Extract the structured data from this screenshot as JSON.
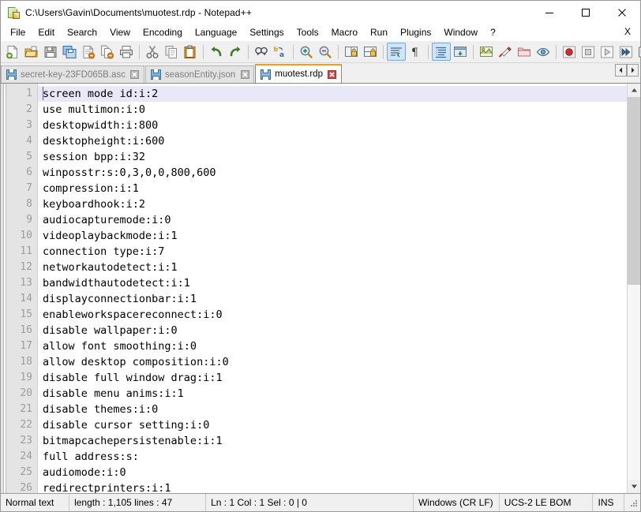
{
  "window": {
    "title": "C:\\Users\\Gavin\\Documents\\muotest.rdp - Notepad++",
    "icon": "notepad-plus-plus-icon",
    "controls": {
      "minimize": "minimize-button",
      "maximize": "maximize-button",
      "close": "close-button"
    }
  },
  "menubar": {
    "items": [
      {
        "label": "File"
      },
      {
        "label": "Edit"
      },
      {
        "label": "Search"
      },
      {
        "label": "View"
      },
      {
        "label": "Encoding"
      },
      {
        "label": "Language"
      },
      {
        "label": "Settings"
      },
      {
        "label": "Tools"
      },
      {
        "label": "Macro"
      },
      {
        "label": "Run"
      },
      {
        "label": "Plugins"
      },
      {
        "label": "Window"
      },
      {
        "label": "?"
      }
    ],
    "close_document_label": "X"
  },
  "toolbar": {
    "items": [
      {
        "name": "new-file-icon",
        "type": "button"
      },
      {
        "name": "open-file-icon",
        "type": "button"
      },
      {
        "name": "save-icon",
        "type": "button"
      },
      {
        "name": "save-all-icon",
        "type": "button"
      },
      {
        "name": "close-file-icon",
        "type": "button"
      },
      {
        "name": "close-all-files-icon",
        "type": "button"
      },
      {
        "name": "print-icon",
        "type": "button"
      },
      {
        "name": "separator",
        "type": "separator"
      },
      {
        "name": "cut-icon",
        "type": "button"
      },
      {
        "name": "copy-icon",
        "type": "button"
      },
      {
        "name": "paste-icon",
        "type": "button"
      },
      {
        "name": "separator",
        "type": "separator"
      },
      {
        "name": "undo-icon",
        "type": "button"
      },
      {
        "name": "redo-icon",
        "type": "button"
      },
      {
        "name": "separator",
        "type": "separator"
      },
      {
        "name": "find-icon",
        "type": "button"
      },
      {
        "name": "replace-icon",
        "type": "button"
      },
      {
        "name": "separator",
        "type": "separator"
      },
      {
        "name": "zoom-in-icon",
        "type": "button"
      },
      {
        "name": "zoom-out-icon",
        "type": "button"
      },
      {
        "name": "separator",
        "type": "separator"
      },
      {
        "name": "sync-vertical-scroll-icon",
        "type": "button"
      },
      {
        "name": "sync-horizontal-scroll-icon",
        "type": "button"
      },
      {
        "name": "separator",
        "type": "separator"
      },
      {
        "name": "word-wrap-icon",
        "type": "toggle",
        "active": true
      },
      {
        "name": "show-all-characters-icon",
        "type": "button"
      },
      {
        "name": "separator",
        "type": "separator"
      },
      {
        "name": "indent-guideline-icon",
        "type": "toggle",
        "active": true
      },
      {
        "name": "user-defined-dialogue-icon",
        "type": "button"
      },
      {
        "name": "separator",
        "type": "separator"
      },
      {
        "name": "document-map-icon",
        "type": "button"
      },
      {
        "name": "function-list-icon",
        "type": "button"
      },
      {
        "name": "folder-as-workspace-icon",
        "type": "button"
      },
      {
        "name": "monitoring-icon",
        "type": "button"
      },
      {
        "name": "separator",
        "type": "separator"
      },
      {
        "name": "record-macro-icon",
        "type": "button"
      },
      {
        "name": "stop-recording-macro-icon",
        "type": "button"
      },
      {
        "name": "play-macro-icon",
        "type": "button"
      },
      {
        "name": "run-macro-multiple-times-icon",
        "type": "button"
      },
      {
        "name": "save-current-macro-icon",
        "type": "button"
      }
    ]
  },
  "tabs": {
    "items": [
      {
        "label": "secret-key-23FD065B.asc",
        "active": false
      },
      {
        "label": "seasonEntity.json",
        "active": false
      },
      {
        "label": "muotest.rdp",
        "active": true
      }
    ],
    "scroll_left": "scroll-tabs-left-button",
    "scroll_right": "scroll-tabs-right-button"
  },
  "editor": {
    "current_line": 1,
    "first_visible_line": 1,
    "lines": [
      {
        "n": "1",
        "text": "screen mode id:i:2"
      },
      {
        "n": "2",
        "text": "use multimon:i:0"
      },
      {
        "n": "3",
        "text": "desktopwidth:i:800"
      },
      {
        "n": "4",
        "text": "desktopheight:i:600"
      },
      {
        "n": "5",
        "text": "session bpp:i:32"
      },
      {
        "n": "6",
        "text": "winposstr:s:0,3,0,0,800,600"
      },
      {
        "n": "7",
        "text": "compression:i:1"
      },
      {
        "n": "8",
        "text": "keyboardhook:i:2"
      },
      {
        "n": "9",
        "text": "audiocapturemode:i:0"
      },
      {
        "n": "10",
        "text": "videoplaybackmode:i:1"
      },
      {
        "n": "11",
        "text": "connection type:i:7"
      },
      {
        "n": "12",
        "text": "networkautodetect:i:1"
      },
      {
        "n": "13",
        "text": "bandwidthautodetect:i:1"
      },
      {
        "n": "14",
        "text": "displayconnectionbar:i:1"
      },
      {
        "n": "15",
        "text": "enableworkspacereconnect:i:0"
      },
      {
        "n": "16",
        "text": "disable wallpaper:i:0"
      },
      {
        "n": "17",
        "text": "allow font smoothing:i:0"
      },
      {
        "n": "18",
        "text": "allow desktop composition:i:0"
      },
      {
        "n": "19",
        "text": "disable full window drag:i:1"
      },
      {
        "n": "20",
        "text": "disable menu anims:i:1"
      },
      {
        "n": "21",
        "text": "disable themes:i:0"
      },
      {
        "n": "22",
        "text": "disable cursor setting:i:0"
      },
      {
        "n": "23",
        "text": "bitmapcachepersistenable:i:1"
      },
      {
        "n": "24",
        "text": "full address:s:"
      },
      {
        "n": "25",
        "text": "audiomode:i:0"
      },
      {
        "n": "26",
        "text": "redirectprinters:i:1"
      }
    ]
  },
  "statusbar": {
    "doc_type": "Normal text",
    "length_lines": "length : 1,105   lines : 47",
    "caret_info": "Ln : 1    Col : 1    Sel : 0 | 0",
    "eol": "Windows (CR LF)",
    "encoding": "UCS-2 LE BOM",
    "insert_mode": "INS"
  },
  "colors": {
    "accent_tab": "#ff9a14",
    "current_line_highlight": "#e8e8f8",
    "window_bg": "#f0f0f0",
    "editor_bg": "#ffffff",
    "gutter_bg": "#e4e4e4",
    "gutter_text": "#9d9d9d"
  }
}
